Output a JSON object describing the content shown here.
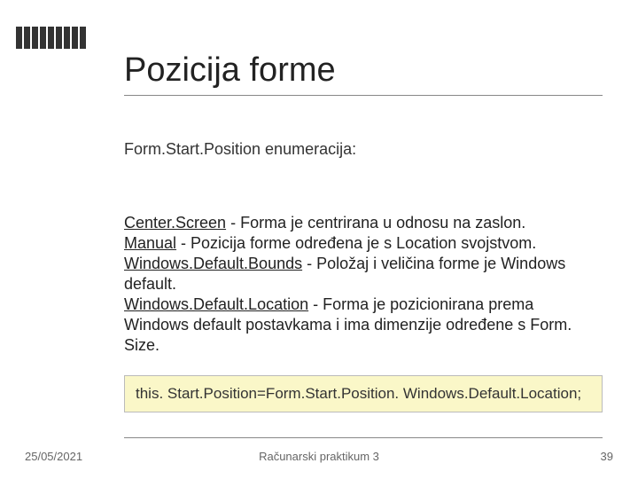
{
  "title": "Pozicija forme",
  "subtitle": "Form.Start.Position enumeracija:",
  "items": [
    {
      "name": "Center.Screen",
      "desc": " - Forma je centrirana u odnosu na zaslon."
    },
    {
      "name": "Manual",
      "desc": " - Pozicija forme određena je s Location svojstvom."
    },
    {
      "name": "Windows.Default.Bounds",
      "desc": " - Položaj i veličina forme je Windows default."
    },
    {
      "name": "Windows.Default.Location",
      "desc": " - Forma je pozicionirana prema Windows default postavkama i ima dimenzije određene s Form. Size."
    }
  ],
  "code": "this. Start.Position=Form.Start.Position. Windows.Default.Location;",
  "footer": {
    "date": "25/05/2021",
    "center": "Računarski praktikum 3",
    "page": "39"
  }
}
